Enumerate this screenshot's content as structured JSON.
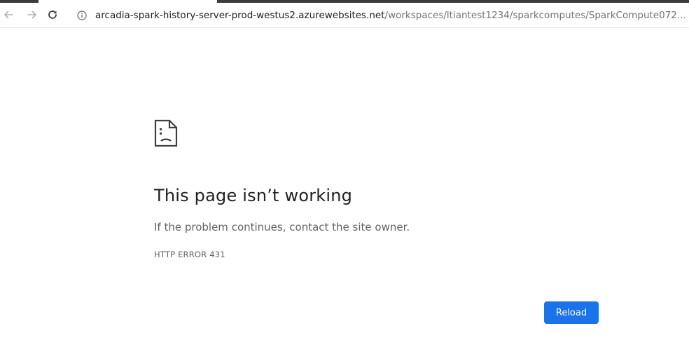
{
  "browser": {
    "url_host": "arcadia-spark-history-server-prod-westus2.azurewebsites.net",
    "url_path": "/workspaces/ltiantest1234/sparkcomputes/SparkCompute072..."
  },
  "error_page": {
    "heading": "This page isn’t working",
    "message": "If the problem continues, contact the site owner.",
    "error_code": "HTTP ERROR 431",
    "reload_label": "Reload"
  },
  "colors": {
    "accent": "#1a73e8",
    "heading": "#202124",
    "secondary_text": "#5f6368"
  },
  "icons": {
    "back": "arrow-left-icon",
    "forward": "arrow-right-icon",
    "reload": "reload-icon",
    "site_info": "info-icon",
    "error": "sad-page-icon"
  }
}
